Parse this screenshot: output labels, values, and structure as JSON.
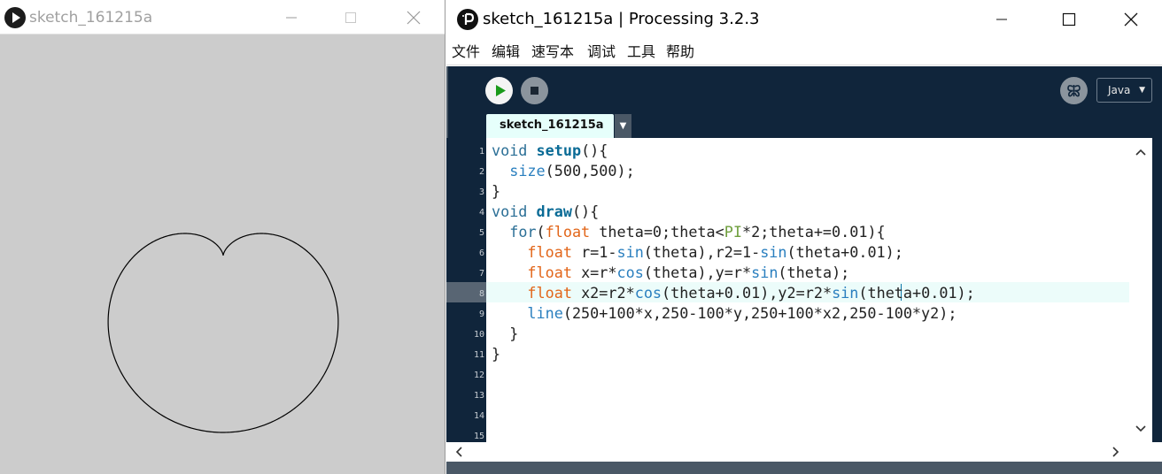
{
  "sketch_window": {
    "title": "sketch_161215a",
    "background_color": "#cccccc",
    "stroke_color": "#000000"
  },
  "ide_window": {
    "title": "sketch_161215a | Processing 3.2.3",
    "menu": [
      "文件",
      "编辑",
      "速写本",
      "调试",
      "工具",
      "帮助"
    ],
    "toolbar": {
      "run_icon": "play-icon",
      "stop_icon": "stop-icon",
      "debug_icon": "debugger-butterfly-icon",
      "mode": "Java"
    },
    "tab": {
      "label": "sketch_161215a"
    },
    "line_numbers": [
      "1",
      "2",
      "3",
      "4",
      "5",
      "6",
      "7",
      "8",
      "9",
      "10",
      "11",
      "12",
      "13",
      "14",
      "15"
    ],
    "current_line": 8,
    "code": [
      "void setup(){",
      "  size(500,500);",
      "}",
      "void draw(){",
      "  for(float theta=0;theta<PI*2;theta+=0.01){",
      "    float r=1-sin(theta),r2=1-sin(theta+0.01);",
      "    float x=r*cos(theta),y=r*sin(theta);",
      "    float x2=r2*cos(theta+0.01),y2=r2*sin(theta+0.01);",
      "    line(250+100*x,250-100*y,250+100*x2,250-100*y2);",
      "  }",
      "}"
    ],
    "colors": {
      "toolbar_bg": "#10253b",
      "keyword": "#2b6f96",
      "function": "#0a6b96",
      "type": "#e2661a",
      "constant": "#6e9e3c",
      "current_line_bg": "#ecfcfa"
    }
  }
}
